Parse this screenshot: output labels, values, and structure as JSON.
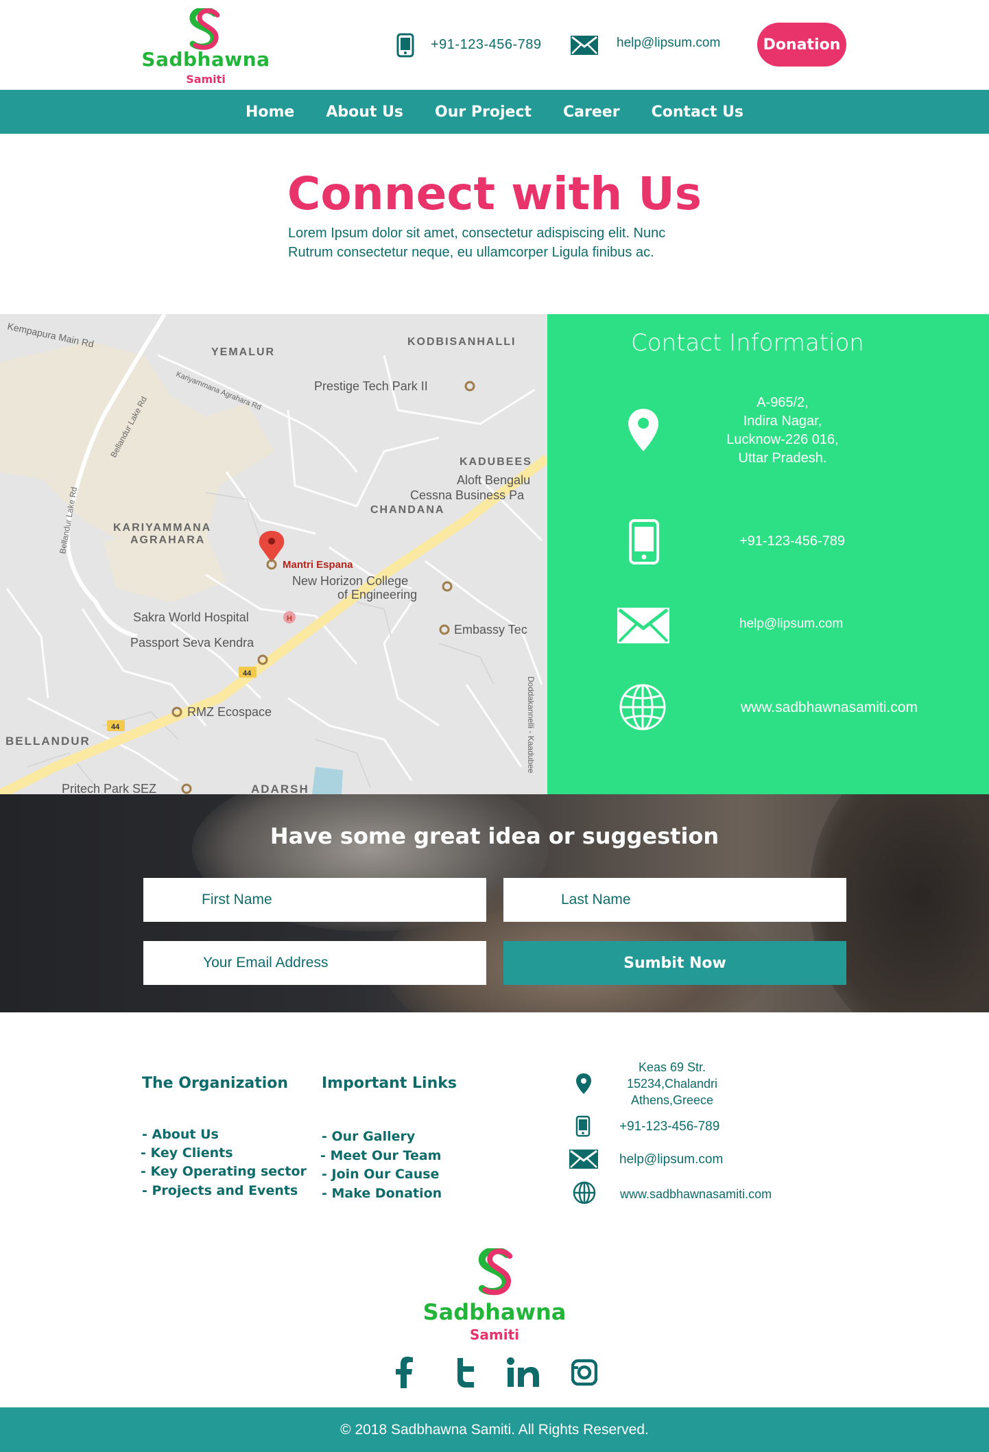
{
  "header": {
    "logo": {
      "brand": "Sadbhawna",
      "sub": "Samiti"
    },
    "phone": "+91-123-456-789",
    "email": "help@lipsum.com",
    "donate_label": "Donation",
    "icons": {
      "phone": "phone-icon",
      "mail": "mail-icon"
    }
  },
  "nav": {
    "items": [
      {
        "label": "Home"
      },
      {
        "label": "About Us"
      },
      {
        "label": "Our Project"
      },
      {
        "label": "Career"
      },
      {
        "label": "Contact Us"
      }
    ]
  },
  "hero": {
    "title": "Connect with Us",
    "text_line1": "Lorem Ipsum dolor sit amet, consectetur adispiscing elit. Nunc",
    "text_line2": "Rutrum consectetur neque, eu ullamcorper Ligula finibus ac."
  },
  "map": {
    "labels": {
      "kempapura": "Kempapura Main Rd",
      "yemalur": "YEMALUR",
      "kodbisanhalli": "KODBISANHALLI",
      "prestige": "Prestige Tech Park II",
      "kariyammana_rd": "Kariyammana Agrahara Rd",
      "bellandur_lake_rd": "Bellandur Lake Rd",
      "bellandur_lake_rd2": "Bellandur Lake Rd",
      "kadubees": "KADUBEES",
      "aloft": "Aloft Bengalu",
      "cessna": "Cessna Business Pa",
      "chandana": "CHANDANA",
      "kariyammana1": "KARIYAMMANA",
      "kariyammana2": "AGRAHARA",
      "mantri": "Mantri Espana",
      "nhce1": "New Horizon College",
      "nhce2": "of Engineering",
      "sakra": "Sakra World Hospital",
      "passport": "Passport Seva Kendra",
      "embassy": "Embassy Tec",
      "highway": "44",
      "rmz": "RMZ Ecospace",
      "bellandur": "BELLANDUR",
      "dodda": "Doddakannelli - Kaadubee",
      "pritech": "Pritech Park SEZ",
      "adarsh": "ADARSH"
    }
  },
  "contact_info": {
    "title": "Contact Information",
    "address": [
      "A-965/2,",
      "Indira Nagar,",
      "Lucknow-226 016,",
      "Uttar Pradesh."
    ],
    "phone": "+91-123-456-789",
    "email": "help@lipsum.com",
    "website": "www.sadbhawnasamiti.com",
    "icons": [
      "location-pin-icon",
      "phone-icon",
      "mail-icon",
      "globe-icon"
    ]
  },
  "suggestion": {
    "title": "Have some great idea or suggestion",
    "first_name_placeholder": "First Name",
    "last_name_placeholder": "Last Name",
    "email_placeholder": "Your Email Address",
    "submit_label": "Sumbit Now"
  },
  "footer": {
    "organization": {
      "title": "The Organization",
      "links": [
        "- About Us",
        "- Key Clients",
        "- Key Operating sector",
        "- Projects and Events"
      ]
    },
    "important": {
      "title": "Important Links",
      "links": [
        "- Our Gallery",
        "- Meet Our Team",
        "- Join Our Cause",
        "- Make Donation"
      ]
    },
    "address": [
      "Keas 69 Str.",
      "15234,Chalandri",
      "Athens,Greece"
    ],
    "phone": "+91-123-456-789",
    "email": "help@lipsum.com",
    "website": "www.sadbhawnasamiti.com",
    "logo": {
      "brand": "Sadbhawna",
      "sub": "Samiti"
    },
    "social": [
      "facebook-icon",
      "twitter-icon",
      "linkedin-icon",
      "instagram-icon"
    ],
    "copyright": "© 2018 Sadbhawna Samiti. All Rights Reserved."
  },
  "colors": {
    "brand_pink": "#e8336b",
    "brand_green": "#22b53a",
    "teal": "#239a96",
    "teal_text": "#0f6b6a",
    "info_green": "#2ee085"
  }
}
